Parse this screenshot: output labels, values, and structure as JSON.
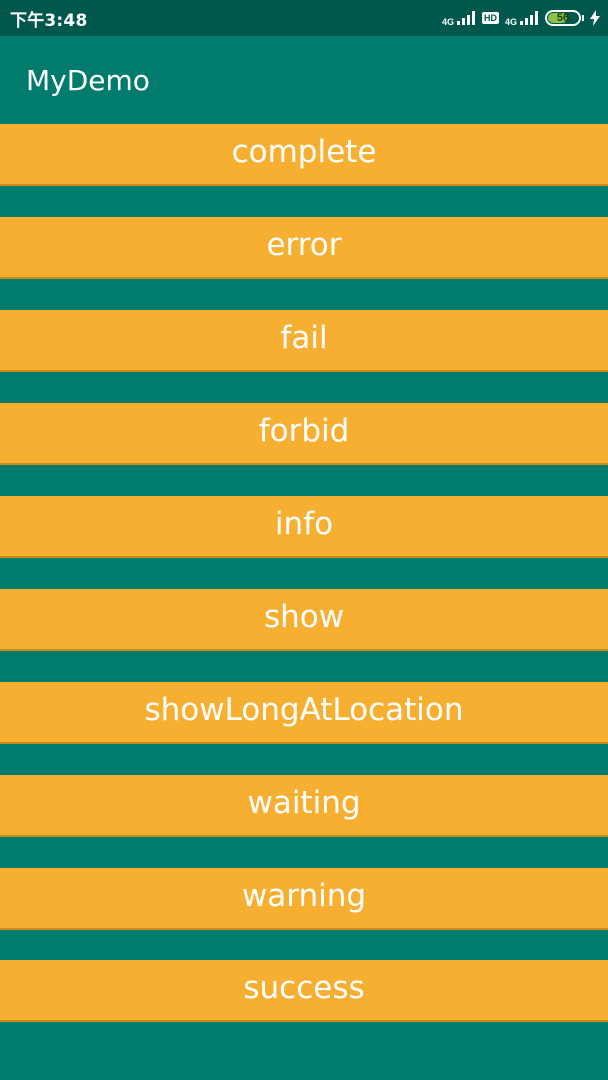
{
  "status_bar": {
    "time": "下午3:48",
    "network_1": "4G",
    "hd": "HD",
    "network_2": "4G",
    "battery_level": "56"
  },
  "app_bar": {
    "title": "MyDemo"
  },
  "buttons": [
    {
      "label": "complete"
    },
    {
      "label": "error"
    },
    {
      "label": "fail"
    },
    {
      "label": "forbid"
    },
    {
      "label": "info"
    },
    {
      "label": "show"
    },
    {
      "label": "showLongAtLocation"
    },
    {
      "label": "waiting"
    },
    {
      "label": "warning"
    },
    {
      "label": "success"
    }
  ],
  "colors": {
    "primary": "#007B6C",
    "primary_dark": "#00574C",
    "button": "#F7AF31",
    "text": "#FFFFFF"
  }
}
